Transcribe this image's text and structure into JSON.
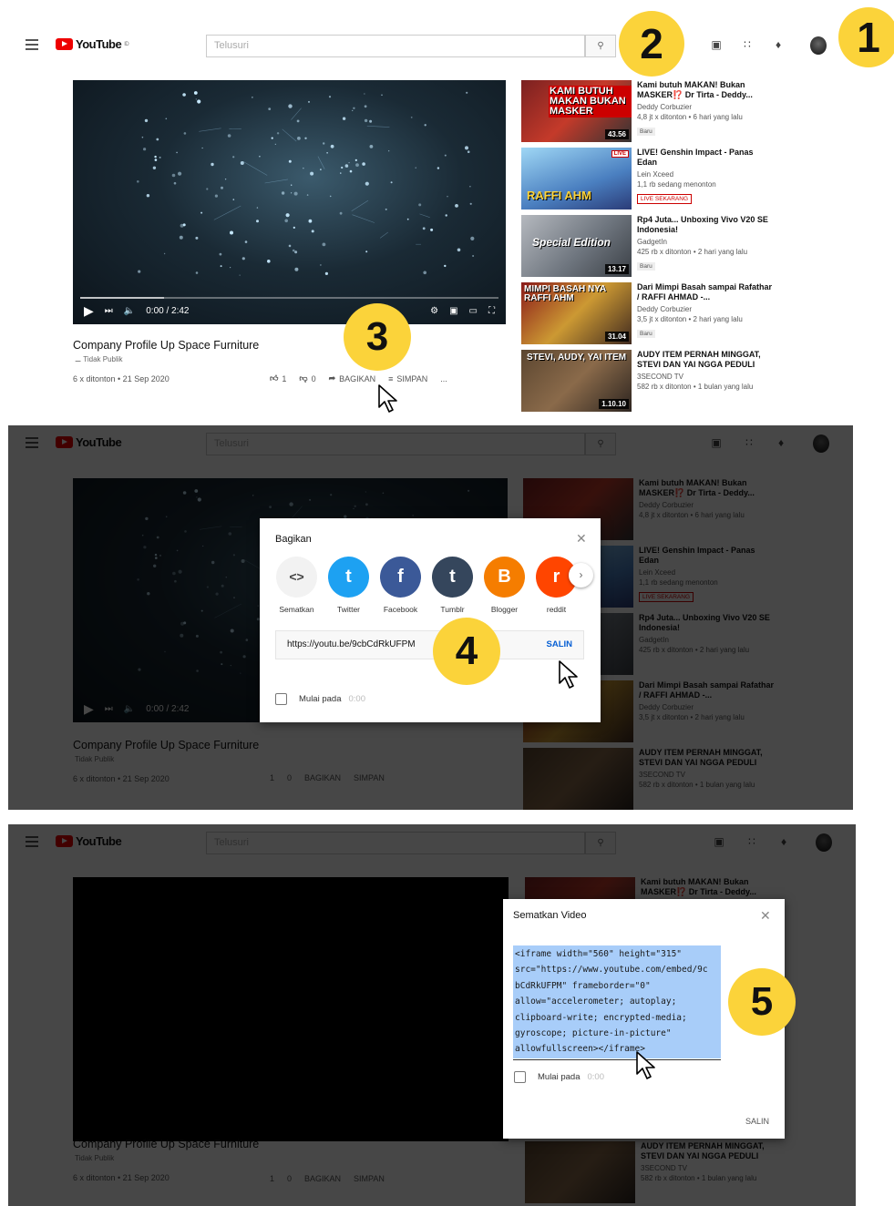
{
  "youtube": {
    "logo_text": "YouTube",
    "logo_sup": "ID",
    "search_placeholder": "Telusuri"
  },
  "video": {
    "title": "Company Profile Up Space Furniture",
    "privacy": "Tidak Publik",
    "stats": "6 x ditonton • 21 Sep 2020",
    "time": "0:00 / 2:42",
    "likes": "1",
    "dislikes": "0",
    "share_label": "BAGIKAN",
    "save_label": "SIMPAN",
    "more": "..."
  },
  "sidebar": [
    {
      "title": "Kami butuh MAKAN! Bukan MASKER⁉️ Dr Tirta - Deddy...",
      "channel": "Deddy Corbuzier",
      "views": "4,8 jt x ditonton • 6 hari yang lalu",
      "badge": "Baru",
      "duration": "43.56",
      "overlay": "KAMI BUTUH MAKAN BUKAN MASKER"
    },
    {
      "title": "LIVE! Genshin Impact - Panas Edan",
      "channel": "Lein Xceed",
      "views": "1,1 rb sedang menonton",
      "badge": "LIVE SEKARANG",
      "duration": "LIVE",
      "overlay": "RAFFI AHM"
    },
    {
      "title": "Rp4 Juta... Unboxing Vivo V20 SE Indonesia!",
      "channel": "GadgetIn",
      "views": "425 rb x ditonton • 2 hari yang lalu",
      "badge": "Baru",
      "duration": "13.17",
      "overlay": "Special Edition"
    },
    {
      "title": "Dari Mimpi Basah sampai Rafathar / RAFFI AHMAD -...",
      "channel": "Deddy Corbuzier",
      "views": "3,5 jt x ditonton • 2 hari yang lalu",
      "badge": "Baru",
      "duration": "31.04",
      "overlay": "MIMPI BASAH NYA RAFFI AHM"
    },
    {
      "title": "AUDY ITEM PERNAH MINGGAT, STEVI DAN YAI NGGA PEDULI",
      "channel": "3SECOND TV",
      "views": "582 rb x ditonton • 1 bulan yang lalu",
      "badge": "",
      "duration": "1.10.10",
      "overlay": "STEVI, AUDY, YAI ITEM"
    }
  ],
  "share_dialog": {
    "title": "Bagikan",
    "options": [
      {
        "label": "Sematkan",
        "glyph": "<>",
        "color": "#f2f2f2"
      },
      {
        "label": "Twitter",
        "glyph": "t",
        "color": "#1da1f2"
      },
      {
        "label": "Facebook",
        "glyph": "f",
        "color": "#3b5998"
      },
      {
        "label": "Tumblr",
        "glyph": "t",
        "color": "#35465c"
      },
      {
        "label": "Blogger",
        "glyph": "B",
        "color": "#f57d00"
      },
      {
        "label": "reddit",
        "glyph": "r",
        "color": "#ff4500"
      }
    ],
    "url": "https://youtu.be/9cbCdRkUFPM",
    "copy_label": "SALIN",
    "start_label": "Mulai pada",
    "start_value": "0:00"
  },
  "embed_dialog": {
    "title": "Sematkan Video",
    "code": "<iframe width=\"560\" height=\"315\"\nsrc=\"https://www.youtube.com/embed/9c\nbCdRkUFPM\" frameborder=\"0\"\nallow=\"accelerometer; autoplay;\nclipboard-write; encrypted-media;\ngyroscope; picture-in-picture\"\nallowfullscreen></iframe>",
    "start_label": "Mulai pada",
    "start_value": "0:00",
    "copy_label": "SALIN"
  },
  "steps": [
    "1",
    "2",
    "3",
    "4",
    "5"
  ],
  "colors": {
    "step_yellow": "#fbd33a",
    "yt_red": "#ff0000",
    "link_blue": "#065fd4",
    "selection": "#a8cdf9"
  }
}
